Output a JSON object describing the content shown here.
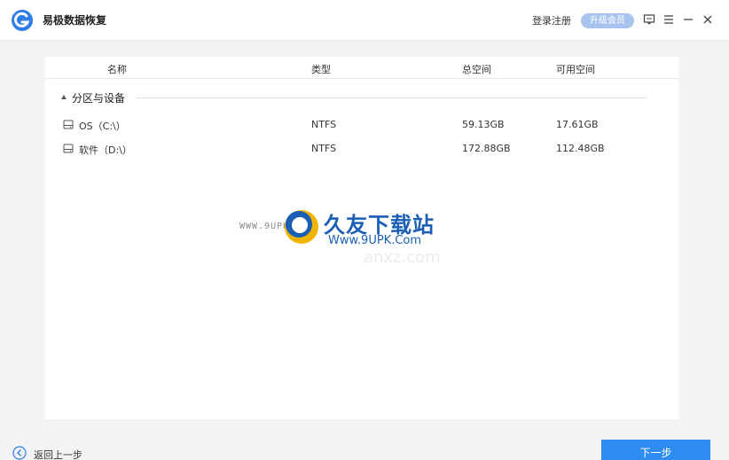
{
  "app": {
    "title": "易极数据恢复",
    "login_label": "登录注册",
    "upgrade_label": "升级会员"
  },
  "icons": {
    "logo": "app-logo-icon",
    "feedback": "message-icon",
    "menu": "menu-icon",
    "minimize": "minimize-icon",
    "close": "close-icon",
    "disk": "hard-disk-icon",
    "back": "arrow-left-circle-icon"
  },
  "colors": {
    "accent": "#2e8cf0",
    "badge": "#a8c4ee",
    "watermark": "#1a5fb4"
  },
  "table": {
    "headers": {
      "name": "名称",
      "type": "类型",
      "total": "总空间",
      "free": "可用空间"
    },
    "group_label": "分区与设备",
    "rows": [
      {
        "name": "OS（C:\\）",
        "type": "NTFS",
        "total": "59.13GB",
        "free": "17.61GB"
      },
      {
        "name": "软件（D:\\）",
        "type": "NTFS",
        "total": "172.88GB",
        "free": "112.48GB"
      }
    ]
  },
  "watermark": {
    "url": "WWW.9UPK.COM",
    "title": "久友下载站",
    "subtitle": "Www.9UPK.Com",
    "ghost": "anxz.com"
  },
  "footer": {
    "back_label": "返回上一步",
    "next_label": "下一步"
  }
}
